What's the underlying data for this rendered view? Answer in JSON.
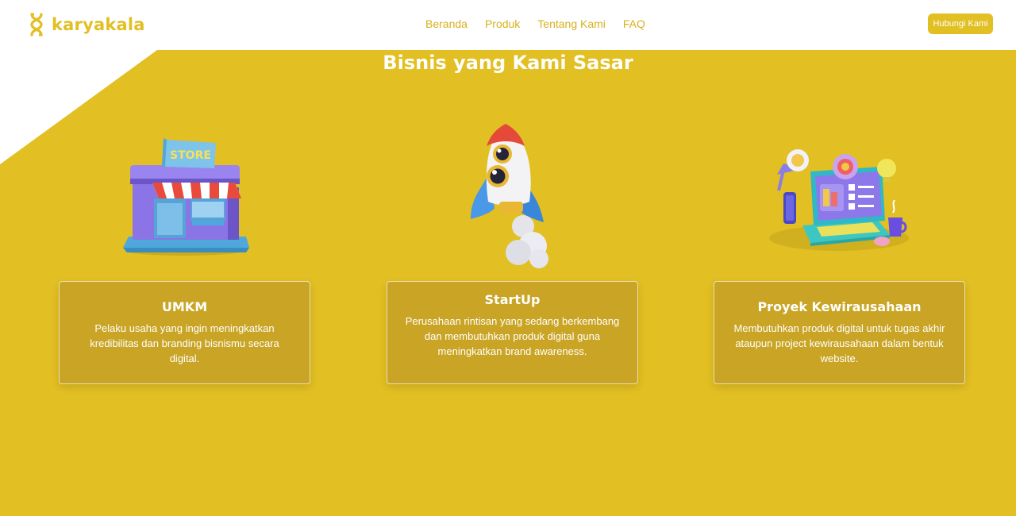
{
  "brand": {
    "name": "karyakala",
    "logo_icon": "karyakala-logo-icon",
    "color": "#e2bf22"
  },
  "nav": [
    {
      "label": "Beranda"
    },
    {
      "label": "Produk"
    },
    {
      "label": "Tentang Kami"
    },
    {
      "label": "FAQ"
    }
  ],
  "cta": {
    "label": "Hubungi Kami"
  },
  "section": {
    "title": "Bisnis yang Kami Sasar",
    "background": "#e2bf22",
    "cards": [
      {
        "title": "UMKM",
        "text": "Pelaku usaha yang ingin meningkatkan kredibilitas dan branding bisnismu secara digital.",
        "icon": "store-illustration",
        "store_sign": "STORE"
      },
      {
        "title": "StartUp",
        "text": "Perusahaan rintisan yang sedang berkembang dan membutuhkan produk digital guna meningkatkan brand awareness.",
        "icon": "rocket-illustration"
      },
      {
        "title": "Proyek Kewirausahaan",
        "text": "Membutuhkan produk digital untuk tugas akhir ataupun project kewirausahaan dalam bentuk website.",
        "icon": "laptop-workspace-illustration"
      }
    ]
  }
}
